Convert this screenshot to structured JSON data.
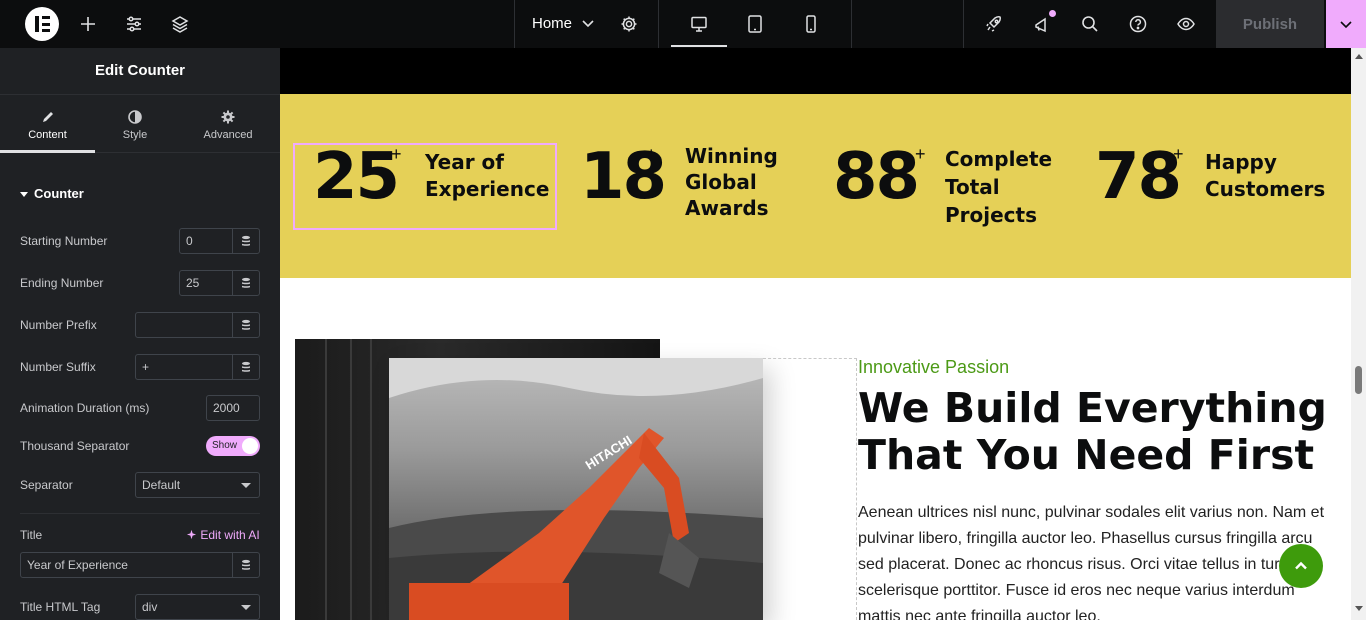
{
  "topbar": {
    "page_name": "Home",
    "publish_label": "Publish"
  },
  "panel": {
    "title": "Edit Counter",
    "tabs": [
      {
        "label": "Content",
        "icon": "pencil-icon"
      },
      {
        "label": "Style",
        "icon": "half-circle-icon"
      },
      {
        "label": "Advanced",
        "icon": "gear-icon"
      }
    ],
    "section": "Counter",
    "fields": {
      "starting_number": {
        "label": "Starting Number",
        "value": "0"
      },
      "ending_number": {
        "label": "Ending Number",
        "value": "25"
      },
      "number_prefix": {
        "label": "Number Prefix",
        "value": ""
      },
      "number_suffix": {
        "label": "Number Suffix",
        "value": "+"
      },
      "animation_duration": {
        "label": "Animation Duration (ms)",
        "value": "2000"
      },
      "thousand_separator": {
        "label": "Thousand Separator",
        "value": "Show"
      },
      "separator": {
        "label": "Separator",
        "value": "Default"
      },
      "title": {
        "label": "Title",
        "value": "Year of Experience"
      },
      "title_html_tag": {
        "label": "Title HTML Tag",
        "value": "div"
      }
    },
    "edit_with_ai": "Edit with AI"
  },
  "counters": [
    {
      "number": "25",
      "suffix": "+",
      "label_lines": [
        "Year of",
        "Experience"
      ]
    },
    {
      "number": "18",
      "suffix": "+",
      "label_lines": [
        "Winning",
        "Global",
        "Awards"
      ]
    },
    {
      "number": "88",
      "suffix": "+",
      "label_lines": [
        "Complete",
        "Total",
        "Projects"
      ]
    },
    {
      "number": "78",
      "suffix": "+",
      "label_lines": [
        "Happy",
        "Customers"
      ]
    }
  ],
  "about": {
    "eyebrow": "Innovative Passion",
    "heading_line1": "We Build Everything",
    "heading_line2": "That You Need First",
    "body": "Aenean ultrices nisl nunc, pulvinar sodales elit varius non. Nam et pulvinar libero, fringilla auctor leo. Phasellus cursus fringilla arcu sed placerat. Donec ac rhoncus risus. Orci vitae tellus in turpis scelerisque porttitor. Fusce id eros nec neque varius interdum mattis nec ante fringilla auctor leo."
  },
  "colors": {
    "accent": "#f0abfc",
    "counter_band": "#e5d057",
    "eyebrow_green": "#4c9a16",
    "to_top": "#3e9b0c"
  }
}
